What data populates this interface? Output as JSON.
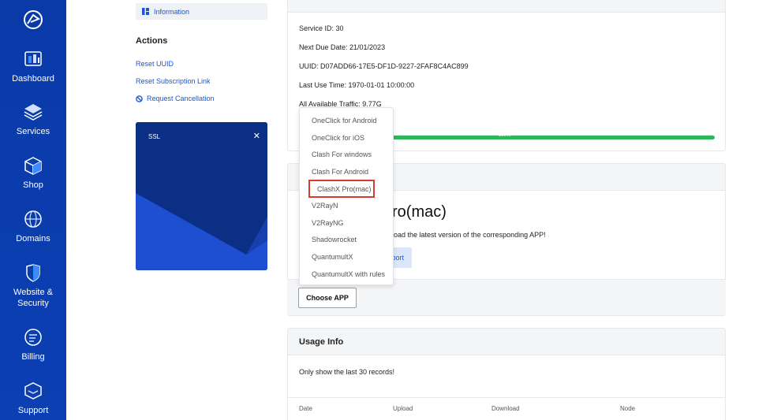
{
  "colors": {
    "sidebar": "#0b3fb3",
    "link": "#1a56d6",
    "progress": "#2db85a",
    "highlight": "#d93a2b"
  },
  "sidebar": {
    "items": [
      {
        "label": "Dashboard",
        "icon": "dashboard-icon"
      },
      {
        "label": "Services",
        "icon": "services-icon"
      },
      {
        "label": "Shop",
        "icon": "shop-icon"
      },
      {
        "label": "Domains",
        "icon": "globe-icon"
      },
      {
        "label": "Website &\nSecurity",
        "label_line1": "Website &",
        "label_line2": "Security",
        "icon": "shield-icon"
      },
      {
        "label": "Billing",
        "icon": "billing-icon"
      },
      {
        "label": "Support",
        "icon": "support-icon"
      }
    ]
  },
  "left": {
    "info_tab": "Information",
    "actions_title": "Actions",
    "actions": [
      "Reset UUID",
      "Reset Subscription Link",
      "Request Cancellation"
    ],
    "ssl_card": {
      "title": "SSL",
      "close": "✕"
    }
  },
  "service": {
    "service_id": "Service ID: 30",
    "next_due": "Next Due Date: 21/01/2023",
    "uuid": "UUID: D07ADD66-17E5-DF1D-9227-2FAF8C4AC899",
    "last_use": "Last Use Time: 1970-01-01 10:00:00",
    "traffic": "All Available Traffic: 9.77G",
    "progress_label": "100%",
    "progress_value": 1.0
  },
  "app": {
    "title_partial": "ro(mac)",
    "download_text": "load the latest version of the corresponding APP!",
    "support_label": "port",
    "choose_label": "Choose APP",
    "dropdown_options": [
      "OneClick for Android",
      "OneClick for iOS",
      "Clash For windows",
      "Clash For Android",
      "ClashX Pro(mac)",
      "V2RayN",
      "V2RayNG",
      "Shadowrocket",
      "QuantumultX",
      "QuantumultX with rules"
    ],
    "selected": "ClashX Pro(mac)"
  },
  "usage": {
    "title": "Usage Info",
    "note": "Only show the last 30 records!",
    "columns": [
      "Date",
      "Upload",
      "Download",
      "Node"
    ]
  }
}
